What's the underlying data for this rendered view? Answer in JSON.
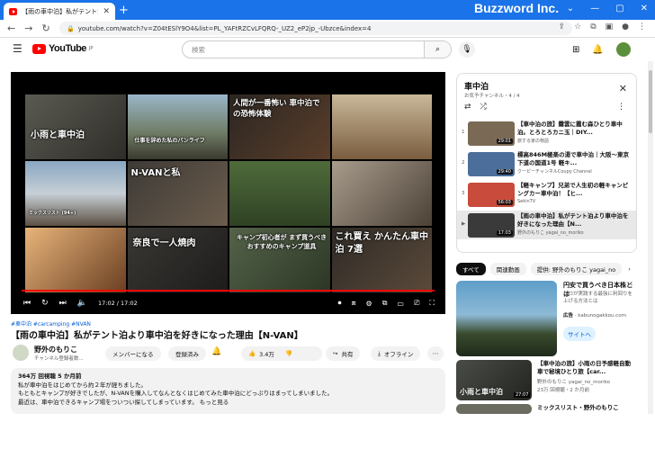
{
  "browser": {
    "tab_title": "【雨の車中泊】私がテント泊より",
    "tab_close": "✕",
    "new_tab": "+",
    "brand": "Buzzword Inc.",
    "url": "youtube.com/watch?v=Z04tESlY9O4&list=PL_YAFtRZCvLFQRQ-_UZ2_eP2jp_-Ubzce&index=4"
  },
  "header": {
    "logo_text": "YouTube",
    "logo_region": "JP",
    "search_placeholder": "検索"
  },
  "video": {
    "thumb_captions": [
      "小雨と車中泊",
      "仕事を辞めた私のバンライフ",
      "人間が一番怖い 車中泊での恐怖体験",
      "",
      "",
      "N-VANと私",
      "",
      "",
      "ミックスリスト (94+)",
      "奈良で一人焼肉",
      "キャンプ初心者が まず買うべき おすすめのキャンプ道具",
      "これ買え かんたん車中泊 7選"
    ],
    "time": "17:02 / 17:02",
    "tags": "#車中泊 #carcamping #NVAN",
    "title": "【雨の車中泊】私がテント泊より車中泊を好きになった理由【N-VAN】",
    "channel_name": "野外のもりこ",
    "channel_subs": "チャンネル登録者数...",
    "member_button": "メンバーになる",
    "subscribed_button": "登録済み",
    "like_count": "3.4万",
    "share_label": "共有",
    "offline_label": "オフライン",
    "stats": "364万 回視聴 5 か月前",
    "desc_lines": [
      "私が車中泊をはじめてから約２年が経ちました。",
      "もともとキャンプが好きでしたが、N-VANを購入してなんとなくはじめてみた車中泊にどっぷりはまってしまいました。",
      "最近は、車中泊できるキャンプ場をついつい探してしまっています。 もっと見る"
    ]
  },
  "playlist": {
    "title": "車中泊",
    "subtitle": "お気予チャンネル・4 / 4",
    "items": [
      {
        "num": "1",
        "title": "【車中泊の旅】霧雲に霞む森ひとり車中泊。とろとろカニ玉｜DIY...",
        "channel": "旅する家の物語",
        "duration": "29:01",
        "color": "#7a6a55"
      },
      {
        "num": "2",
        "title": "標高846M極楽の湯で車中泊｜大阪〜東京下道の国道1号 軽キ...",
        "channel": "クーピーチャンネルCoupy Channel",
        "duration": "29:40",
        "color": "#4b6f9a"
      },
      {
        "num": "3",
        "title": "【軽キャンプ】兄弟で人生初の軽キャンピングカー車中泊！【ヒ...",
        "channel": "SekinTV",
        "duration": "56:03",
        "color": "#c94b3b"
      },
      {
        "num": "▶",
        "title": "【雨の車中泊】私がテント泊より車中泊を好きになった理由【N...",
        "channel": "野外のもりこ yagai_no_moriko",
        "duration": "17:03",
        "color": "#3a3a3a"
      }
    ]
  },
  "chips": [
    "すべて",
    "関連動画",
    "提供: 野外のもりこ yagai_no"
  ],
  "ad": {
    "title": "円安で買うべき日本株とは",
    "desc": "プロが実践する最強に利回りを上げる方法とは",
    "label": "広告",
    "source": "kabunogakkou.com",
    "site_button": "サイトへ"
  },
  "recs": [
    {
      "title": "【車中泊の旅】小雨の日予感軽自動車で秘境ひとり旅【car...",
      "channel": "野外のもりこ yagai_no_moriko",
      "views": "23万 回視聴・2 か月前",
      "duration": "27:07",
      "caption": "小雨と車中泊"
    },
    {
      "title": "ミックスリスト・野外のもりこ",
      "channel": "",
      "views": "",
      "duration": "",
      "caption": ""
    }
  ]
}
